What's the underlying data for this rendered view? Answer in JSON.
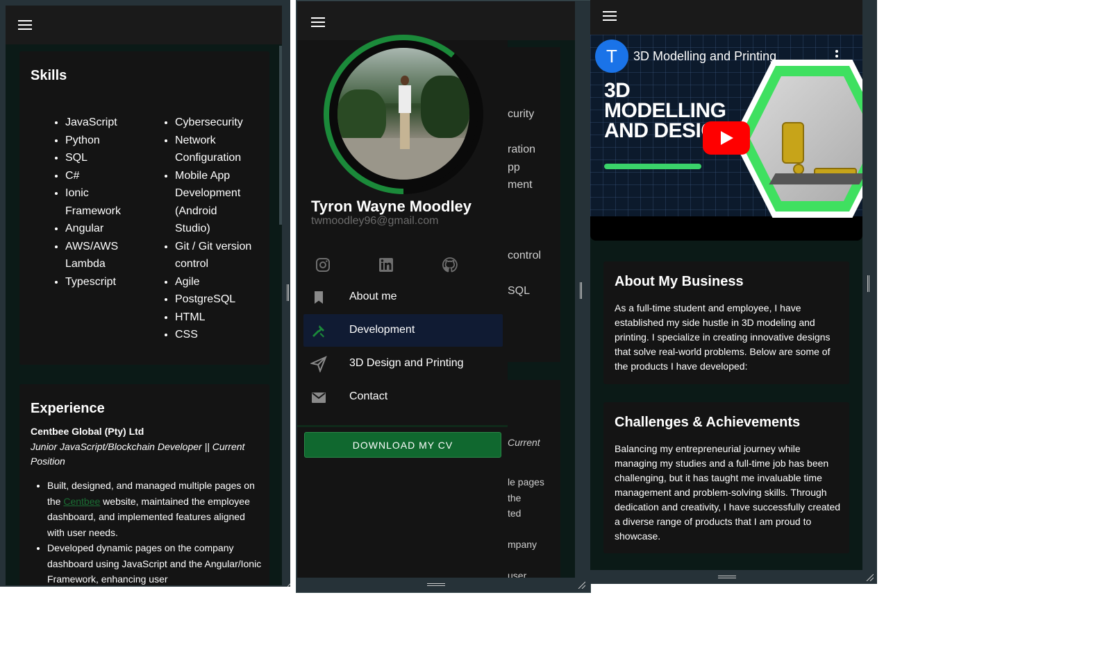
{
  "panel1": {
    "skills": {
      "title": "Skills",
      "col1": [
        "JavaScript",
        "Python",
        "SQL",
        "C#",
        "Ionic Framework",
        "Angular",
        "AWS/AWS Lambda",
        "Typescript"
      ],
      "col2": [
        "Cybersecurity",
        "Network Configuration",
        "Mobile App Development (Android Studio)",
        "Git / Git version control",
        "Agile",
        "PostgreSQL",
        "HTML",
        "CSS"
      ]
    },
    "experience": {
      "title": "Experience",
      "company": "Centbee Global (Pty) Ltd",
      "role": "Junior JavaScript/Blockchain Developer || Current Position",
      "bullet1_before": "Built, designed, and managed multiple pages on the ",
      "bullet1_link": "Centbee",
      "bullet1_after": " website, maintained the employee dashboard, and implemented features aligned with user needs.",
      "bullet2": "Developed dynamic pages on the company dashboard using JavaScript and the Angular/Ionic Framework, enhancing user"
    }
  },
  "panel2": {
    "profile": {
      "name": "Tyron Wayne Moodley",
      "email": "twmoodley96@gmail.com"
    },
    "social": [
      "instagram-icon",
      "linkedin-icon",
      "github-icon"
    ],
    "nav": [
      {
        "label": "About me",
        "icon": "bookmark-icon",
        "active": false
      },
      {
        "label": "Development",
        "icon": "tools-icon",
        "active": true
      },
      {
        "label": "3D Design and Printing",
        "icon": "paper-plane-icon",
        "active": false
      },
      {
        "label": "Contact",
        "icon": "envelope-icon",
        "active": false
      }
    ],
    "cv_button": "DOWNLOAD MY CV",
    "background_fragments": [
      "curity",
      "ration",
      "pp",
      "ment",
      "control",
      "SQL",
      "Current",
      "le pages",
      "the",
      "ted",
      "mpany",
      "user"
    ]
  },
  "panel3": {
    "video": {
      "channel_initial": "T",
      "title": "3D Modelling and Printing",
      "thumbnail_text": "3D MODELLING AND DESIGN"
    },
    "about": {
      "title": "About My Business",
      "body": "As a full-time student and employee, I have established my side hustle in 3D modeling and printing. I specialize in creating innovative designs that solve real-world problems. Below are some of the products I have developed:"
    },
    "challenges": {
      "title": "Challenges & Achievements",
      "body": "Balancing my entrepreneurial journey while managing my studies and a full-time job has been challenging, but it has taught me invaluable time management and problem-solving skills. Through dedication and creativity, I have successfully created a diverse range of products that I am proud to showcase."
    }
  },
  "colors": {
    "accent_green": "#10682f",
    "active_nav_bg": "#101b33",
    "page_bg": "#0b1a17",
    "card_bg": "#141414",
    "youtube_red": "#ff0000"
  }
}
